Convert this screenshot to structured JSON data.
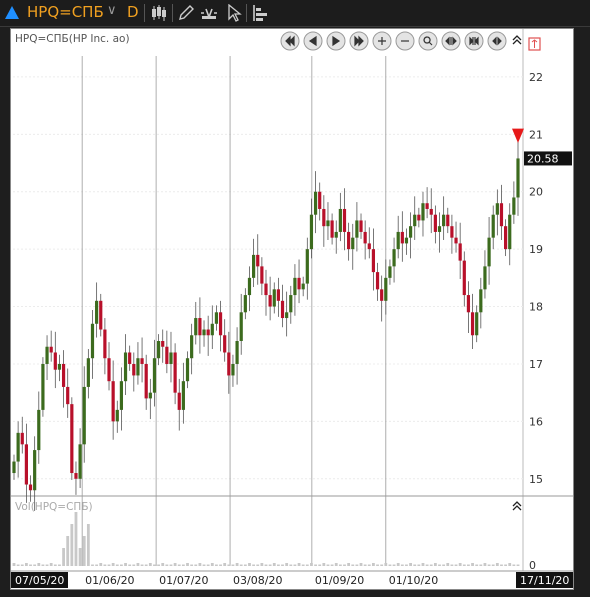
{
  "toolbar": {
    "symbol": "HPQ=СПБ",
    "period": "D",
    "icons": [
      "triangle-up-icon",
      "chevron-down-icon",
      "candlestick-icon",
      "pencil-icon",
      "chart-type-icon",
      "cursor-icon",
      "bars-icon"
    ]
  },
  "chart": {
    "title": "HPQ=СПБ(HP Inc. ao)",
    "volume_title": "Vol(HPQ=СПБ)",
    "volume_zero": "0",
    "last_price_label": "20.58",
    "nav_buttons": [
      "rewind-icon",
      "step-back-icon",
      "play-icon",
      "fast-forward-icon",
      "zoom-in-icon",
      "zoom-out-icon",
      "zoom-rect-icon",
      "expand-h-icon",
      "compress-h-icon",
      "shrink-h-icon"
    ],
    "colors": {
      "up": "#3c6b1e",
      "down": "#b8102a",
      "marker": "#e61919",
      "accent": "#f0a020"
    }
  },
  "chart_data": {
    "type": "candlestick",
    "ylim": [
      14.7,
      22.8
    ],
    "y_ticks": [
      22,
      21,
      20,
      19,
      18,
      17,
      16,
      15
    ],
    "x_labels": [
      "07/05/20",
      "01/06/20",
      "01/07/20",
      "03/08/20",
      "01/09/20",
      "01/10/20",
      "17/11/20"
    ],
    "x_ref_days": {
      "start": 0,
      "end": 194
    },
    "last_price": 20.58,
    "grid": true,
    "close": [
      15.3,
      15.8,
      15.6,
      14.9,
      14.8,
      15.5,
      16.2,
      17.0,
      17.3,
      17.2,
      16.9,
      17.0,
      16.6,
      16.3,
      15.1,
      15.0,
      15.6,
      16.6,
      17.1,
      17.7,
      18.1,
      17.6,
      17.1,
      16.7,
      16.0,
      16.2,
      16.7,
      17.2,
      17.0,
      16.8,
      17.1,
      17.0,
      16.4,
      16.5,
      17.1,
      17.4,
      17.3,
      17.0,
      17.2,
      16.5,
      16.2,
      16.7,
      17.1,
      17.5,
      17.8,
      17.5,
      17.6,
      17.5,
      17.7,
      17.9,
      17.5,
      17.2,
      16.8,
      17.0,
      17.4,
      17.9,
      18.2,
      18.5,
      18.9,
      18.7,
      18.4,
      18.2,
      18.0,
      18.3,
      18.1,
      17.8,
      17.9,
      18.2,
      18.5,
      18.3,
      18.4,
      19.0,
      19.6,
      20.0,
      19.7,
      19.4,
      19.5,
      19.2,
      19.3,
      19.7,
      19.3,
      19.0,
      19.2,
      19.5,
      19.3,
      19.1,
      19.0,
      18.6,
      18.3,
      18.1,
      18.5,
      18.7,
      19.0,
      19.3,
      19.1,
      19.2,
      19.4,
      19.6,
      19.5,
      19.8,
      19.7,
      19.6,
      19.3,
      19.4,
      19.6,
      19.4,
      19.2,
      19.1,
      18.8,
      18.2,
      17.9,
      17.5,
      17.9,
      18.3,
      18.7,
      19.2,
      19.6,
      19.8,
      19.4,
      19.0,
      19.6,
      19.9,
      20.58
    ]
  }
}
